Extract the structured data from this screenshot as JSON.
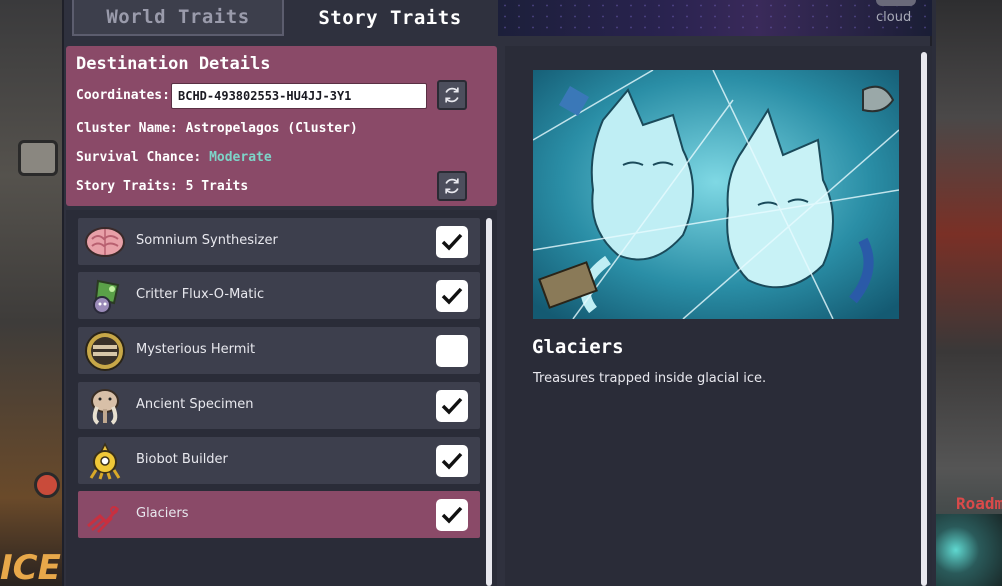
{
  "background": {
    "left_logo_text": "ICE",
    "right_label": "Roadm"
  },
  "tabs": [
    {
      "label": "World Traits",
      "active": false
    },
    {
      "label": "Story Traits",
      "active": true
    }
  ],
  "banner": {
    "label": "cloud"
  },
  "destination": {
    "title": "Destination Details",
    "coordinates_label": "Coordinates:",
    "coordinates_value": "BCHD-493802553-HU4JJ-3Y1",
    "cluster_label": "Cluster Name: Astropelagos (Cluster)",
    "survival_label": "Survival Chance: ",
    "survival_value": "Moderate",
    "story_traits_label": "Story Traits: 5 Traits"
  },
  "traits": [
    {
      "name": "Somnium Synthesizer",
      "icon": "brain-icon",
      "checked": true,
      "selected": false
    },
    {
      "name": "Critter Flux-O-Matic",
      "icon": "critter-icon",
      "checked": true,
      "selected": false
    },
    {
      "name": "Mysterious Hermit",
      "icon": "hermit-icon",
      "checked": false,
      "selected": false
    },
    {
      "name": "Ancient Specimen",
      "icon": "mammoth-icon",
      "checked": true,
      "selected": false
    },
    {
      "name": "Biobot Builder",
      "icon": "biobot-icon",
      "checked": true,
      "selected": false
    },
    {
      "name": "Glaciers",
      "icon": "glacier-icon",
      "checked": true,
      "selected": true
    }
  ],
  "detail": {
    "title": "Glaciers",
    "description": "Treasures trapped inside glacial ice."
  },
  "colors": {
    "panel": "#2f313e",
    "accent": "#8a4a68",
    "row": "#3d3f4d",
    "survival": "#7ed4c8"
  }
}
